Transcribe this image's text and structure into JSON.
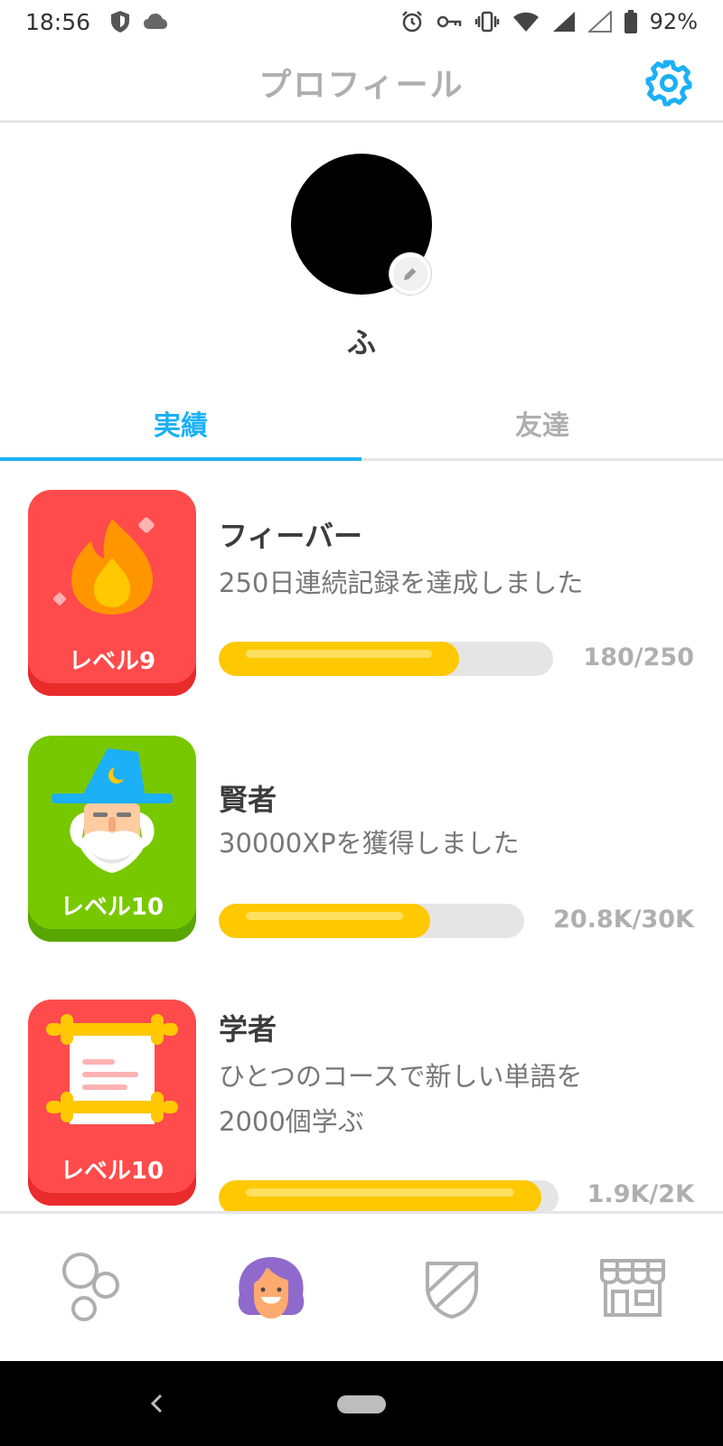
{
  "status_bar": {
    "time": "18:56",
    "battery": "92%"
  },
  "header": {
    "title": "プロフィール"
  },
  "profile": {
    "username": "ふ"
  },
  "tabs": [
    {
      "label": "実績",
      "active": true
    },
    {
      "label": "友達",
      "active": false
    }
  ],
  "achievements": [
    {
      "title": "フィーバー",
      "description": "250日連続記録を達成しました",
      "level_label": "レベル9",
      "progress_text": "180/250",
      "progress": 0.72,
      "badge_color": "#ff4b4b"
    },
    {
      "title": "賢者",
      "description": "30000XPを獲得しました",
      "level_label": "レベル10",
      "progress_text": "20.8K/30K",
      "progress": 0.693,
      "badge_color": "#78c800"
    },
    {
      "title": "学者",
      "description_line1": "ひとつのコースで新しい単語を",
      "description_line2": "2000個学ぶ",
      "level_label": "レベル10",
      "progress_text": "1.9K/2K",
      "progress": 0.95,
      "badge_color": "#ff4b4b"
    }
  ],
  "bottom_nav": [
    {
      "icon": "learn-icon",
      "active": false
    },
    {
      "icon": "profile-icon",
      "active": true
    },
    {
      "icon": "league-shield-icon",
      "active": false
    },
    {
      "icon": "shop-icon",
      "active": false
    }
  ],
  "colors": {
    "accent": "#1cb0f6",
    "progress": "#ffc800",
    "muted": "#afafaf"
  }
}
